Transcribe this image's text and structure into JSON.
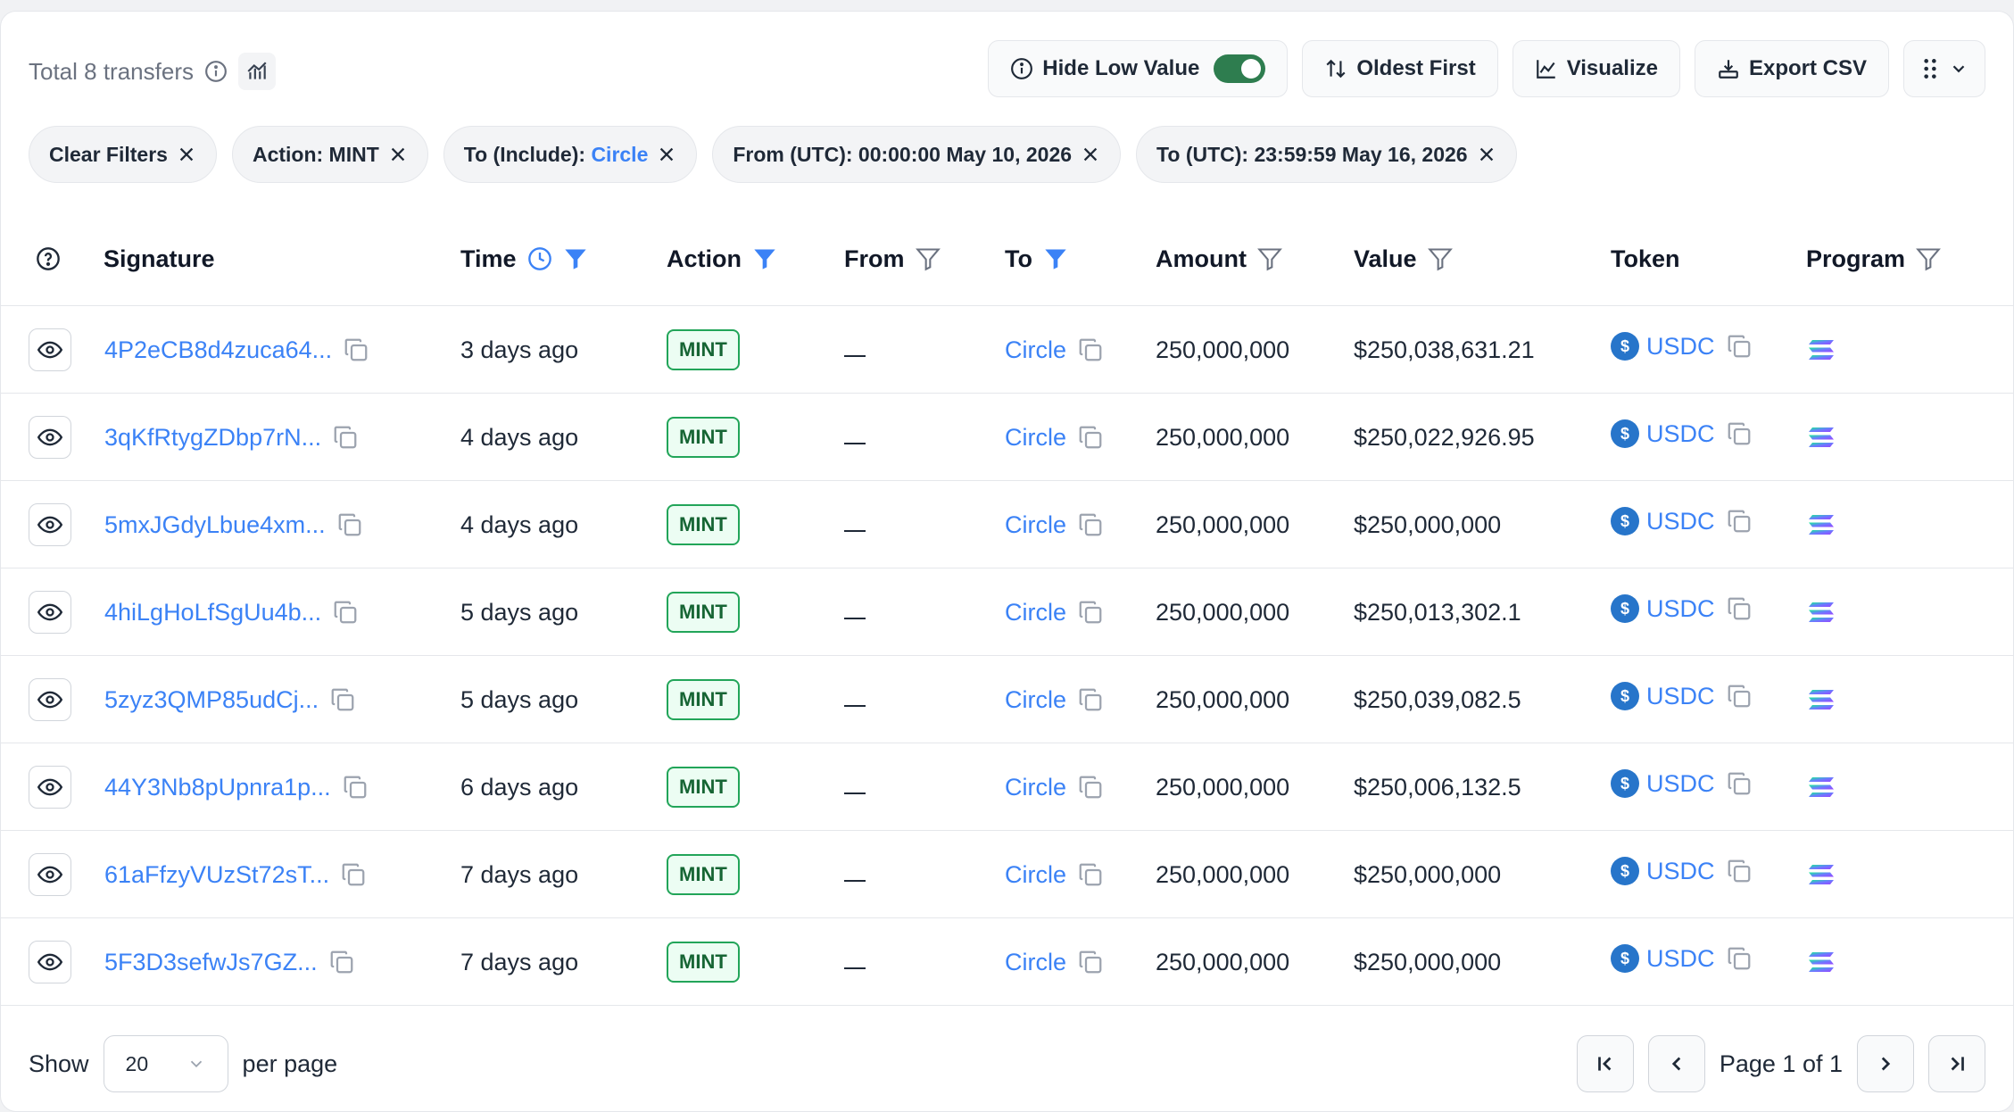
{
  "header": {
    "total_label": "Total 8 transfers",
    "hide_low_value_label": "Hide Low Value",
    "hide_low_value_on": true,
    "sort_label": "Oldest First",
    "visualize_label": "Visualize",
    "export_label": "Export CSV"
  },
  "chips": [
    {
      "label": "Clear Filters",
      "value": ""
    },
    {
      "label": "Action: MINT",
      "value": ""
    },
    {
      "label": "To (Include): ",
      "value": "Circle"
    },
    {
      "label": "From (UTC): 00:00:00 May 10, 2026",
      "value": ""
    },
    {
      "label": "To (UTC): 23:59:59 May 16, 2026",
      "value": ""
    }
  ],
  "columns": {
    "signature": "Signature",
    "time": "Time",
    "action": "Action",
    "from": "From",
    "to": "To",
    "amount": "Amount",
    "value": "Value",
    "token": "Token",
    "program": "Program"
  },
  "rows": [
    {
      "signature": "4P2eCB8d4zuca64...",
      "time": "3 days ago",
      "action": "MINT",
      "to": "Circle",
      "amount": "250,000,000",
      "value": "$250,038,631.21",
      "token": "USDC"
    },
    {
      "signature": "3qKfRtygZDbp7rN...",
      "time": "4 days ago",
      "action": "MINT",
      "to": "Circle",
      "amount": "250,000,000",
      "value": "$250,022,926.95",
      "token": "USDC"
    },
    {
      "signature": "5mxJGdyLbue4xm...",
      "time": "4 days ago",
      "action": "MINT",
      "to": "Circle",
      "amount": "250,000,000",
      "value": "$250,000,000",
      "token": "USDC"
    },
    {
      "signature": "4hiLgHoLfSgUu4b...",
      "time": "5 days ago",
      "action": "MINT",
      "to": "Circle",
      "amount": "250,000,000",
      "value": "$250,013,302.1",
      "token": "USDC"
    },
    {
      "signature": "5zyz3QMP85udCj...",
      "time": "5 days ago",
      "action": "MINT",
      "to": "Circle",
      "amount": "250,000,000",
      "value": "$250,039,082.5",
      "token": "USDC"
    },
    {
      "signature": "44Y3Nb8pUpnra1p...",
      "time": "6 days ago",
      "action": "MINT",
      "to": "Circle",
      "amount": "250,000,000",
      "value": "$250,006,132.5",
      "token": "USDC"
    },
    {
      "signature": "61aFfzyVUzSt72sT...",
      "time": "7 days ago",
      "action": "MINT",
      "to": "Circle",
      "amount": "250,000,000",
      "value": "$250,000,000",
      "token": "USDC"
    },
    {
      "signature": "5F3D3sefwJs7GZ...",
      "time": "7 days ago",
      "action": "MINT",
      "to": "Circle",
      "amount": "250,000,000",
      "value": "$250,000,000",
      "token": "USDC"
    }
  ],
  "footer": {
    "show_label": "Show",
    "per_page_value": "20",
    "per_page_label": "per page",
    "page_label": "Page 1 of 1"
  },
  "colors": {
    "link": "#3b82f6",
    "mint_border": "#22a559",
    "toggle_on": "#2e7d4f",
    "usdc": "#2775ca"
  }
}
